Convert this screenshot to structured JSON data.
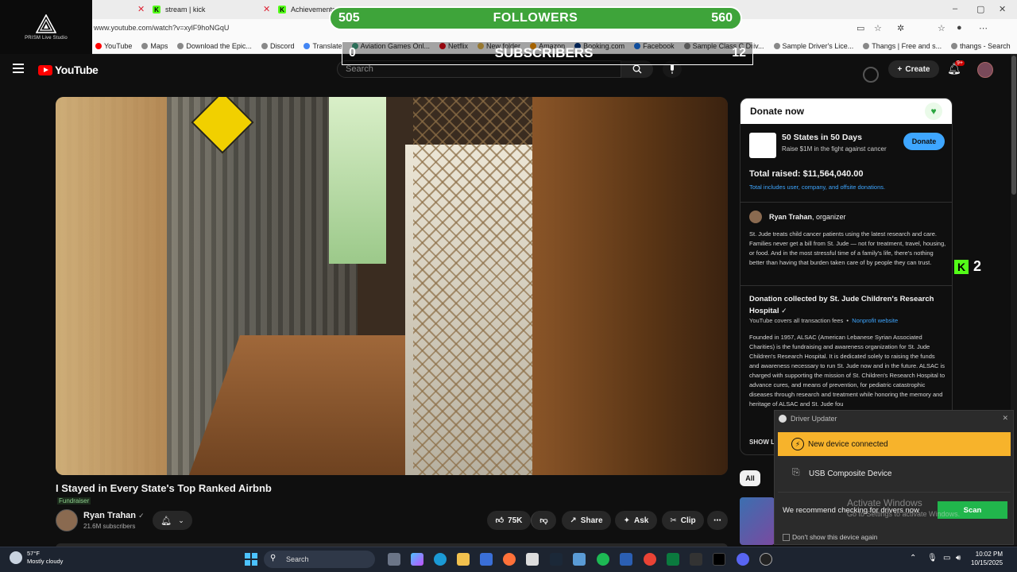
{
  "browser": {
    "tabs": [
      {
        "label": "stream | kick"
      },
      {
        "label": "Achievements"
      }
    ],
    "url": "www.youtube.com/watch?v=xylF9hoNGqU",
    "bookmarks": [
      "YouTube",
      "Maps",
      "Download the Epic...",
      "Discord",
      "Translate",
      "Aviation Games Onl...",
      "Netflix",
      "New folder",
      "Amazon",
      "Booking.com",
      "Facebook",
      "Sample Class C Driv...",
      "Sample Driver's Lice...",
      "Thangs | Free and s...",
      "thangs - Search"
    ]
  },
  "prism": {
    "label": "PRISM Live Studio"
  },
  "overlay": {
    "followers": {
      "left": "505",
      "title": "FOLLOWERS",
      "right": "560"
    },
    "subscribers": {
      "left": "0",
      "title": "SUBSCRIBERS",
      "right": "12"
    },
    "kick_counter": "2"
  },
  "youtube": {
    "logo": "YouTube",
    "search_placeholder": "Search",
    "create": "Create",
    "notif_count": "9+",
    "video": {
      "title": "I Stayed in Every State's Top Ranked Airbnb",
      "fundraiser": "Fundraiser",
      "channel": "Ryan Trahan",
      "subscribers": "21.6M subscribers",
      "likes": "75K",
      "share": "Share",
      "ask": "Ask",
      "clip": "Clip"
    },
    "chip_all": "All"
  },
  "donate": {
    "header": "Donate now",
    "campaign": "50 States in 50 Days",
    "campaign_sub": "Raise $1M in the fight against cancer",
    "button": "Donate",
    "total": "Total raised: $11,564,040.00",
    "note": "Total includes user, company, and offsite donations.",
    "organizer_name": "Ryan Trahan",
    "organizer_role": ", organizer",
    "organizer_desc": "St. Jude treats child cancer patients using the latest research and care. Families never get a bill from St. Jude — not for treatment, travel, housing, or food. And in the most stressful time of a family's life, there's nothing better than having that burden taken care of by people they can trust.",
    "collected_by": "Donation collected by St. Jude Children's Research Hospital",
    "fees": "YouTube covers all transaction fees",
    "nonprofit_link": "Nonprofit website",
    "founded": "Founded in 1957, ALSAC (American Lebanese Syrian Associated Charities) is the fundraising and awareness organization for St. Jude Children's Research Hospital. It is dedicated solely to raising the funds and awareness necessary to run St. Jude now and in the future. ALSAC is charged with supporting the mission of St. Children's Research Hospital to advance cures, and means of prevention, for pediatric catastrophic diseases through research and treatment while honoring the memory and heritage of ALSAC and St. Jude fou",
    "show_less": "SHOW L"
  },
  "driver_popup": {
    "title": "Driver Updater",
    "new_device": "New device connected",
    "device_name": "USB Composite Device",
    "recommend": "We recommend checking for drivers now",
    "scan": "Scan",
    "dont_show": "Don't show this device again"
  },
  "activate_windows": {
    "line1": "Activate Windows",
    "line2": "Go to Settings to activate Windows."
  },
  "taskbar": {
    "temperature": "57°F",
    "weather": "Mostly cloudy",
    "search": "Search",
    "time": "10:02 PM",
    "date": "10/15/2025"
  }
}
